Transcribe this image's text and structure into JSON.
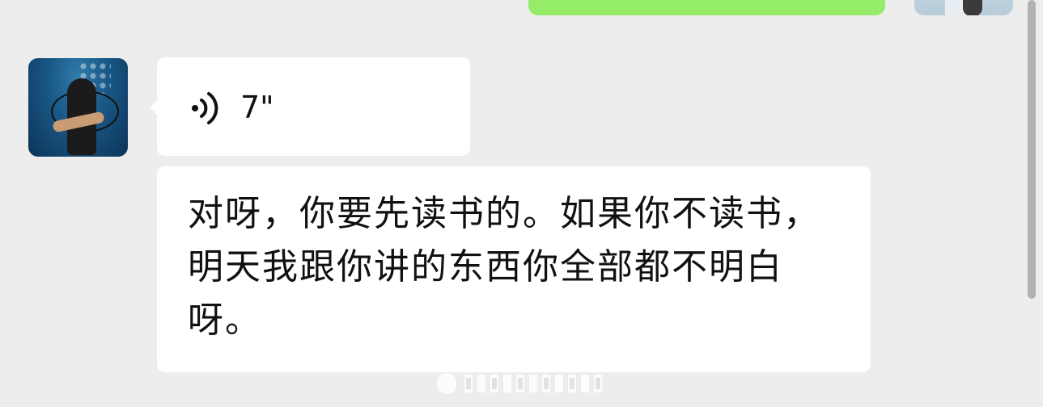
{
  "conversation": {
    "messages": [
      {
        "direction": "outgoing",
        "type": "text",
        "text": ""
      },
      {
        "direction": "incoming",
        "type": "voice",
        "duration": "7\""
      },
      {
        "direction": "incoming",
        "type": "text",
        "text": "对呀，你要先读书的。如果你不读书，明天我跟你讲的东西你全部都不明白呀。"
      }
    ]
  },
  "colors": {
    "background": "#ededed",
    "outgoing_bubble": "#95ec69",
    "incoming_bubble": "#ffffff",
    "text": "#111111"
  },
  "icons": {
    "voice": "voice-wave-icon"
  }
}
